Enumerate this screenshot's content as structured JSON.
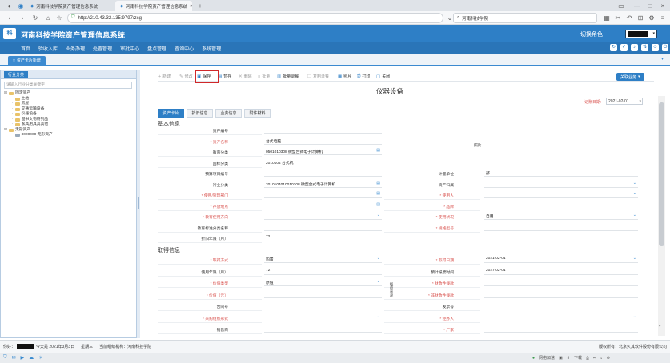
{
  "browser": {
    "tabs": [
      {
        "title": "河南科技学院资产管理信息系统"
      },
      {
        "title": "河南科技学院资产管理信息系统"
      }
    ],
    "new_tab": "+",
    "url": "http://210.43.32.135:9797/zcgl",
    "search_text": "河南科技学院"
  },
  "app": {
    "title": "河南科技学院资产管理信息系统",
    "switch_role": "切换角色",
    "menu": [
      "首页",
      "验收入库",
      "业务办理",
      "处置管理",
      "审批中心",
      "盘点管理",
      "查询中心",
      "系统管理"
    ],
    "page_tab": "资产卡片新增"
  },
  "sidebar": {
    "title": "行业分类",
    "search_placeholder": "请输入行业分类关键字",
    "tree": [
      {
        "indent": 0,
        "label": "固定资产"
      },
      {
        "indent": 1,
        "label": "土地"
      },
      {
        "indent": 1,
        "label": "房屋"
      },
      {
        "indent": 1,
        "label": "交通运输设备"
      },
      {
        "indent": 1,
        "label": "仪器设备"
      },
      {
        "indent": 1,
        "label": "图书文物特列品"
      },
      {
        "indent": 1,
        "label": "家具用具其其他"
      },
      {
        "indent": 0,
        "label": "无形资产"
      },
      {
        "indent": 1,
        "label": "8000000 无形资产"
      }
    ]
  },
  "toolbar": {
    "items": [
      {
        "label": "新建",
        "icon": "+",
        "disabled": true
      },
      {
        "label": "修改",
        "icon": "✎",
        "disabled": true
      },
      {
        "label": "保存",
        "icon": "▣",
        "disabled": false
      },
      {
        "label": "暂存",
        "icon": "▤",
        "disabled": false
      },
      {
        "label": "删除",
        "icon": "✕",
        "disabled": true
      },
      {
        "label": "批量",
        "icon": "≡",
        "disabled": true
      },
      {
        "label": "批量录餐",
        "icon": "▥",
        "disabled": false
      },
      {
        "label": "复制录餐",
        "icon": "❐",
        "disabled": true
      },
      {
        "label": "照片",
        "icon": "▦",
        "disabled": false
      },
      {
        "label": "打印",
        "icon": "⎙",
        "disabled": false
      },
      {
        "label": "关闭",
        "icon": "▢",
        "disabled": false
      }
    ],
    "expand_all": "关联业务"
  },
  "form": {
    "title": "仪器设备",
    "record_date_label": "记账日期:",
    "record_date": "2021-02-01",
    "tabs": [
      "资产卡片",
      "折旧信息",
      "业务信息",
      "附件材料"
    ],
    "basic_section": "基本信息",
    "acquire_section": "取得信息",
    "photo_label": "照片",
    "basic": [
      {
        "left": {
          "label": "资产编号",
          "req": false,
          "value": "",
          "pick": false
        },
        "right": null
      },
      {
        "left": {
          "label": "资产名称",
          "req": true,
          "value": "台式电脑",
          "pick": false
        },
        "right": null
      },
      {
        "left": {
          "label": "教育分类",
          "req": false,
          "value": "0501010308  微型台式电子计算机",
          "pick": true
        },
        "right": null
      },
      {
        "left": {
          "label": "国标分类",
          "req": false,
          "value": "2010104 台式机",
          "pick": false
        },
        "right": null
      },
      {
        "left": {
          "label": "预算项目编号",
          "req": false,
          "value": "",
          "pick": false
        },
        "right": {
          "label": "计量单位",
          "req": false,
          "value": "部",
          "pick": false
        }
      },
      {
        "left": {
          "label": "行业分类",
          "req": false,
          "value": "2010104010010308  微型台式电子计算机",
          "pick": true
        },
        "right": {
          "label": "资产归属",
          "req": false,
          "value": "",
          "pick": true
        }
      },
      {
        "left": {
          "label": "使用/管理部门",
          "req": true,
          "value": "",
          "pick": true
        },
        "right": {
          "label": "使用人",
          "req": true,
          "value": "",
          "pick": true
        }
      },
      {
        "left": {
          "label": "存放地点",
          "req": true,
          "value": "",
          "pick": true
        },
        "right": {
          "label": "品牌",
          "req": true,
          "value": "",
          "pick": false
        }
      },
      {
        "left": {
          "label": "教育使用方向",
          "req": true,
          "value": "",
          "pick": true
        },
        "right": {
          "label": "使用状况",
          "req": true,
          "value": "自用",
          "pick": true
        }
      },
      {
        "left": {
          "label": "教育标准分类名称",
          "req": false,
          "value": "",
          "pick": false
        },
        "right": {
          "label": "规格型号",
          "req": true,
          "value": "",
          "pick": false
        }
      },
      {
        "left": {
          "label": "折旧年限（月）",
          "req": false,
          "value": "72",
          "pick": false
        },
        "right": null
      }
    ],
    "acquire": [
      {
        "left": {
          "label": "取得方式",
          "req": true,
          "value": "购置",
          "pick": true
        },
        "right": {
          "label": "取得日期",
          "req": true,
          "value": "2021-02-01",
          "pick": true
        }
      },
      {
        "left": {
          "label": "使用年限（月）",
          "req": false,
          "value": "72",
          "pick": false
        },
        "right": {
          "label": "预计报废时间",
          "req": false,
          "value": "2027-02-01",
          "pick": false
        }
      },
      {
        "left": {
          "label": "价值类型",
          "req": true,
          "value": "原值",
          "pick": true
        },
        "right": {
          "label": "财政性拨款",
          "req": true,
          "value": "",
          "pick": false
        }
      },
      {
        "left": {
          "label": "价值（元）",
          "req": true,
          "value": "",
          "pick": false
        },
        "right": {
          "label": "非财政性拨款",
          "req": true,
          "value": "",
          "pick": false
        }
      },
      {
        "left": {
          "label": "合同号",
          "req": false,
          "value": "",
          "pick": false
        },
        "right": {
          "label": "发票号",
          "req": false,
          "value": "",
          "pick": false
        }
      },
      {
        "left": {
          "label": "采购组织形式",
          "req": true,
          "value": "",
          "pick": true
        },
        "right": {
          "label": "经办人",
          "req": true,
          "value": "",
          "pick": true
        }
      },
      {
        "left": {
          "label": "销售商",
          "req": false,
          "value": "",
          "pick": false
        },
        "right": {
          "label": "厂家",
          "req": true,
          "value": "",
          "pick": false
        }
      }
    ],
    "funding_source_label": "经费来源"
  },
  "status": {
    "user_label": "你好：",
    "greeting": "今天是  2021年3月3日",
    "weekday": "星期三",
    "org_label": "当前组织机构：河南科技学院",
    "copyright": "版权所有：北京久其软件股份有限公司"
  },
  "bottom": {
    "accel": "网络加速",
    "items": [
      "下载",
      "",
      ""
    ]
  },
  "colors": {
    "header": "#2e7fc6",
    "menu": "#2a75b8",
    "highlight_box": "#d0282a"
  }
}
